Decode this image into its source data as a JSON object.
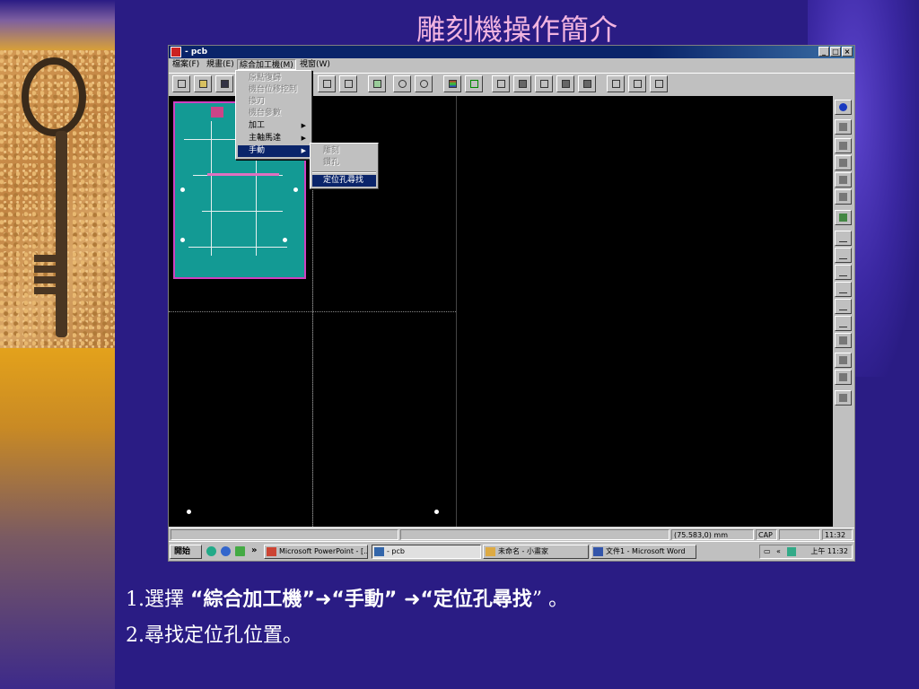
{
  "slide": {
    "title": "雕刻機操作簡介",
    "instructions": {
      "line1_prefix": "1.選擇",
      "line1_q1": "“",
      "line1_menu": "綜合加工機",
      "line1_q2": "”➜“",
      "line1_sub": "手動",
      "line1_q3": "” ➜“",
      "line1_item": "定位孔尋找",
      "line1_q4": "” 。",
      "line2": "2.尋找定位孔位置。"
    }
  },
  "window": {
    "title": "- pcb",
    "buttons": {
      "minimize": "_",
      "maximize": "□",
      "close": "×"
    }
  },
  "menubar": [
    {
      "label": "檔案(F)"
    },
    {
      "label": "規畫(E)"
    },
    {
      "label": "綜合加工機(M)"
    },
    {
      "label": "視窗(W)"
    }
  ],
  "dropdown_main": {
    "items": [
      {
        "label": "原點復歸",
        "disabled": true
      },
      {
        "label": "機台位移控制",
        "disabled": true
      },
      {
        "label": "換刀",
        "disabled": true
      },
      {
        "label": "機台參數",
        "disabled": true
      },
      {
        "label": "加工",
        "disabled": false
      },
      {
        "label": "主軸馬達",
        "disabled": false
      },
      {
        "label": "手動",
        "disabled": false,
        "selected": true
      }
    ]
  },
  "dropdown_sub": {
    "items": [
      {
        "label": "雕刻",
        "disabled": true
      },
      {
        "label": "鑽孔",
        "disabled": true
      },
      {
        "label": "定位孔尋找",
        "disabled": false,
        "selected": true
      }
    ]
  },
  "statusbar": {
    "coords": "(75.583,0) mm",
    "cap": "CAP",
    "time": "11:32"
  },
  "taskbar": {
    "start": "開始",
    "chevron": "»",
    "tasks": [
      {
        "label": "Microsoft PowerPoint - [..."
      },
      {
        "label": "- pcb"
      },
      {
        "label": "未命名 - 小畫家"
      },
      {
        "label": "文件1 - Microsoft Word"
      }
    ],
    "tray_time": "上午 11:32",
    "tray_chevron": "«"
  },
  "colors": {
    "slide_bg": "#2a1c84",
    "title_color": "#f2b4e0",
    "titlebar": "#0a246a",
    "pcb_board": "#139a94",
    "pcb_border": "#d040c0"
  }
}
